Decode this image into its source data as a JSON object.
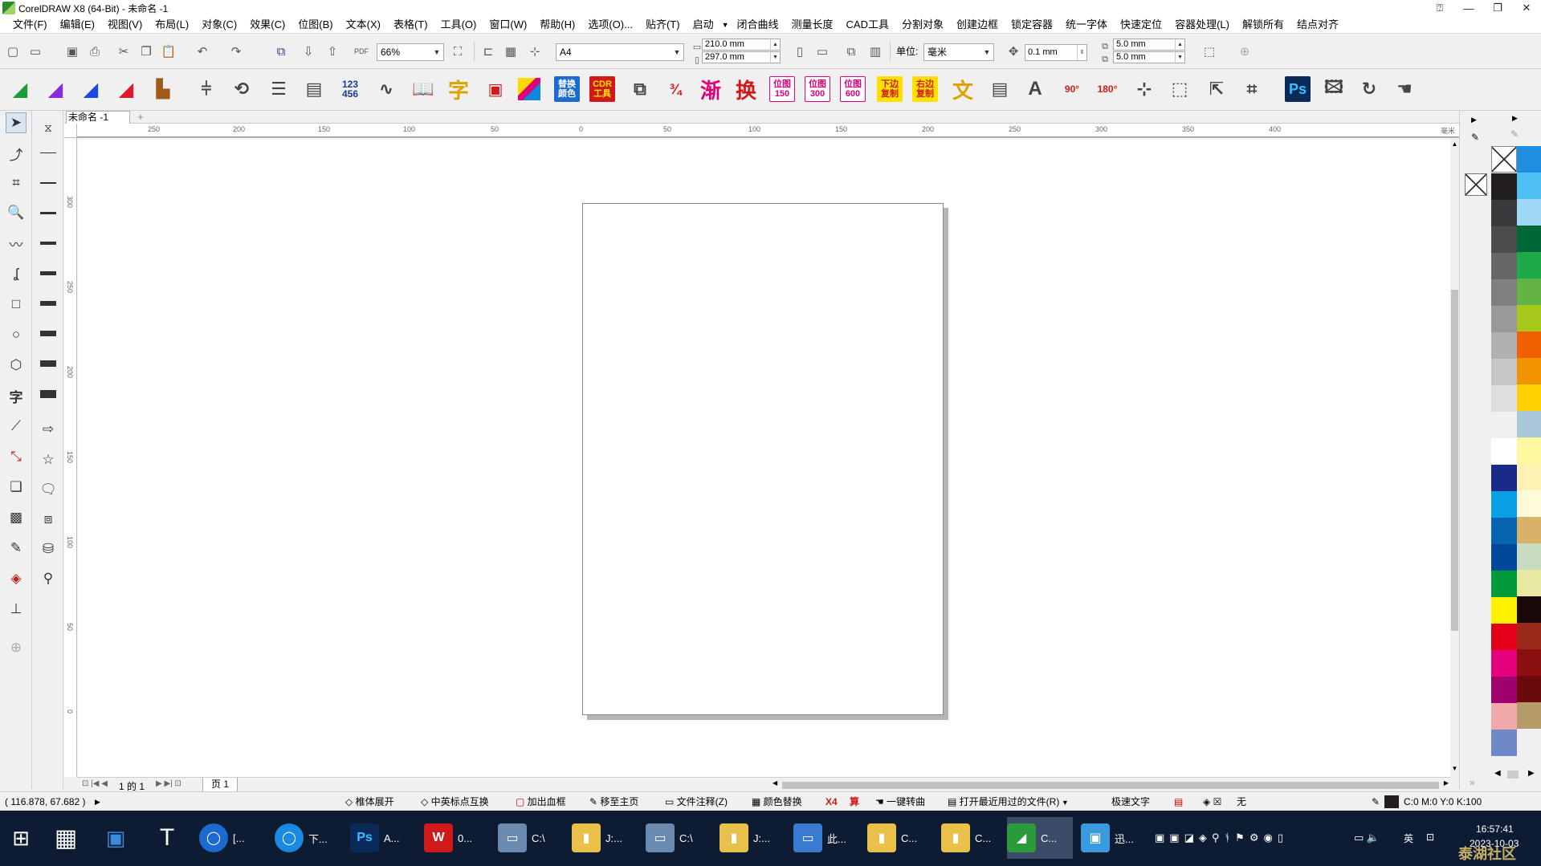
{
  "window": {
    "title": "CorelDRAW X8 (64-Bit) - 未命名 -1",
    "minimize": "—",
    "restore": "❐",
    "close": "✕"
  },
  "menu": [
    "文件(F)",
    "编辑(E)",
    "视图(V)",
    "布局(L)",
    "对象(C)",
    "效果(C)",
    "位图(B)",
    "文本(X)",
    "表格(T)",
    "工具(O)",
    "窗口(W)",
    "帮助(H)",
    "选项(O)...",
    "贴齐(T)",
    "启动",
    "闭合曲线",
    "测量长度",
    "CAD工具",
    "分割对象",
    "创建边框",
    "锁定容器",
    "统一字体",
    "快速定位",
    "容器处理(L)",
    "解锁所有",
    "结点对齐"
  ],
  "toolbar": {
    "zoom": "66%",
    "paper_size": "A4",
    "width": "210.0 mm",
    "height": "297.0 mm",
    "units_label": "单位:",
    "units": "毫米",
    "nudge": "0.1 mm",
    "dup_x": "5.0 mm",
    "dup_y": "5.0 mm"
  },
  "plugin_bar": {
    "t_swap": "替换\n颜色",
    "t_cdr": "CDR\n工具",
    "t_jian": "渐",
    "t_huan": "换",
    "t_w150": "位图\n150",
    "t_w300": "位图\n300",
    "t_w600": "位图\n600",
    "t_xia": "下边\n复制",
    "t_you": "右边\n复制",
    "t_wen": "文",
    "t_zi": "字",
    "t_123": "123\n456",
    "t_ps": "Ps",
    "t_90": "90°",
    "t_180": "180°",
    "t_x4": "X4",
    "t_suan": "算"
  },
  "doc_tab": "未命名 -1",
  "ruler": {
    "unit": "毫米",
    "h_labels": [
      "250",
      "200",
      "150",
      "100",
      "50",
      "0",
      "50",
      "100",
      "150",
      "200",
      "250",
      "300",
      "350",
      "400"
    ],
    "v_labels": [
      "300",
      "250",
      "200",
      "150",
      "100",
      "50",
      "0"
    ]
  },
  "page_nav": {
    "of": "1 的 1",
    "tab": "页 1"
  },
  "status": {
    "coords": "( 116.878, 67.682 )",
    "items": [
      "椎体展开",
      "中英标点互换",
      "加出血框",
      "移至主页",
      "文件注释(Z)",
      "颜色替换",
      "一键转曲",
      "打开最近用过的文件(R)",
      "极速文字"
    ],
    "fill_none": "无",
    "color_readout": "C:0 M:0 Y:0 K:100"
  },
  "taskbar": {
    "apps": [
      "[...",
      "下...",
      "A...",
      "0...",
      "C:\\",
      "J:...",
      "C:\\",
      "J:...",
      "此...",
      "C...",
      "C...",
      "C...",
      "迅..."
    ],
    "ps_label": "Ps",
    "time": "16:57:41",
    "date": "2023-10-03",
    "ime": "英",
    "watermark": "泰湖社区"
  },
  "colors": {
    "palette_col1": [
      "#221e1f",
      "#3a3a3c",
      "#4d4d4f",
      "#676767",
      "#7f7f7f",
      "#999999",
      "#b0b0b0",
      "#c7c7c7",
      "#dedede",
      "#f0f0f0",
      "#ffffff",
      "#1b2a8a",
      "#0aa0e6",
      "#0764b0",
      "#00489c",
      "#009a3a",
      "#fff200",
      "#e5001a",
      "#e6007e",
      "#a0006e",
      "#f0a8a8",
      "#6f88c8"
    ],
    "palette_col2": [
      "#1e8fe0",
      "#4fc0f2",
      "#9fd8f5",
      "#006837",
      "#1faa4a",
      "#63b345",
      "#a6c81a",
      "#f06000",
      "#f29400",
      "#ffd000",
      "#a8c8d8",
      "#fff8a0",
      "#fff2b2",
      "#fffbd8",
      "#d9b26a",
      "#c8dcc0",
      "#e8e8a0",
      "#1a0a0a",
      "#9a2a1a",
      "#8a1010",
      "#6a0a0a",
      "#b59a6a"
    ]
  }
}
